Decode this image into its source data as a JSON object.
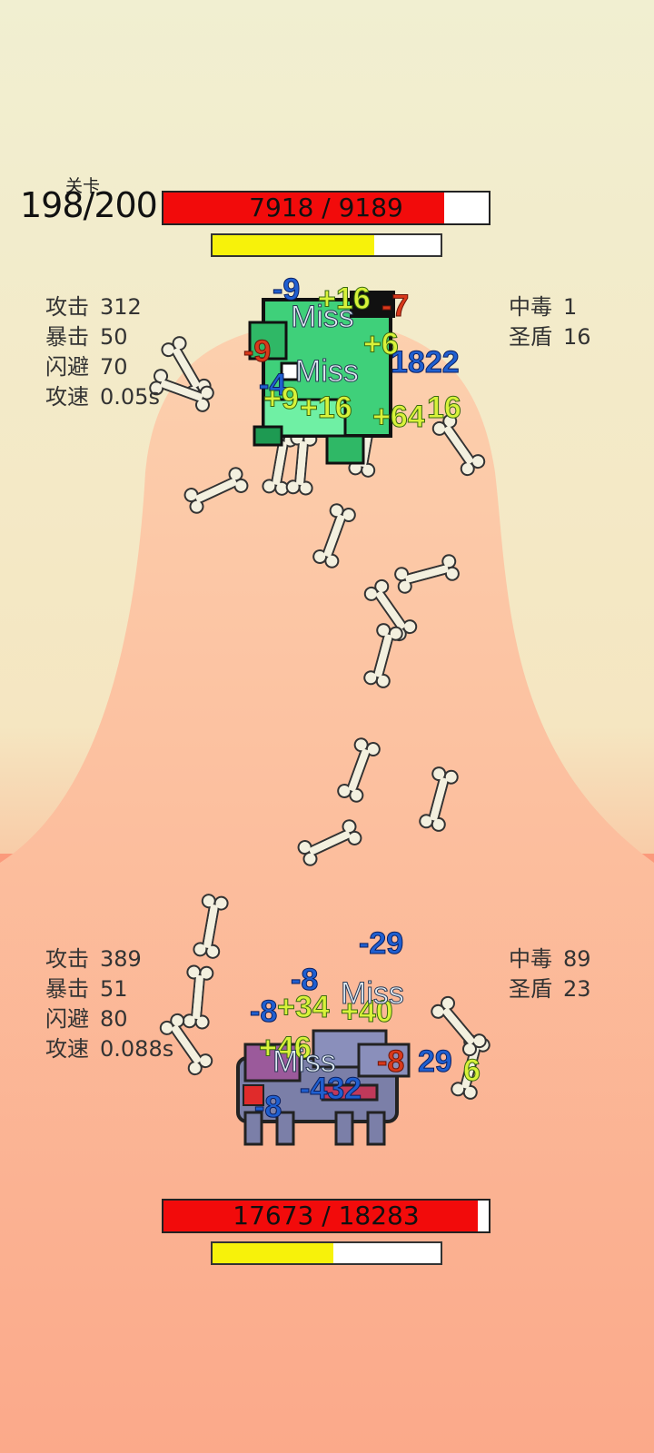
{
  "stage": {
    "label": "关卡",
    "value": "198/200"
  },
  "enemy": {
    "hp_text": "7918 / 9189",
    "hp_fraction": 0.862,
    "energy_fraction": 0.71,
    "stats_left": [
      {
        "name": "攻击",
        "value": "312"
      },
      {
        "name": "暴击",
        "value": "50"
      },
      {
        "name": "闪避",
        "value": "70"
      },
      {
        "name": "攻速",
        "value": "0.05s"
      }
    ],
    "stats_right": [
      {
        "name": "中毒",
        "value": "1"
      },
      {
        "name": "圣盾",
        "value": "16"
      }
    ],
    "floating_numbers": [
      {
        "text": "-9",
        "style": "blue"
      },
      {
        "text": "+16",
        "style": "green"
      },
      {
        "text": "-7",
        "style": "red"
      },
      {
        "text": "Miss",
        "style": "miss"
      },
      {
        "text": "-9",
        "style": "red"
      },
      {
        "text": "+6",
        "style": "green"
      },
      {
        "text": "1822",
        "style": "blue"
      },
      {
        "text": "Miss",
        "style": "miss"
      },
      {
        "text": "-4",
        "style": "blue"
      },
      {
        "text": "+9",
        "style": "green"
      },
      {
        "text": "+16",
        "style": "green"
      },
      {
        "text": "+64",
        "style": "green"
      },
      {
        "text": "16",
        "style": "green"
      }
    ]
  },
  "player": {
    "hp_text": "17673 / 18283",
    "hp_fraction": 0.967,
    "energy_fraction": 0.53,
    "stats_left": [
      {
        "name": "攻击",
        "value": "389"
      },
      {
        "name": "暴击",
        "value": "51"
      },
      {
        "name": "闪避",
        "value": "80"
      },
      {
        "name": "攻速",
        "value": "0.088s"
      }
    ],
    "stats_right": [
      {
        "name": "中毒",
        "value": "89"
      },
      {
        "name": "圣盾",
        "value": "23"
      }
    ],
    "floating_numbers": [
      {
        "text": "-29",
        "style": "blue"
      },
      {
        "text": "-8",
        "style": "blue"
      },
      {
        "text": "-8",
        "style": "blue"
      },
      {
        "text": "+34",
        "style": "green"
      },
      {
        "text": "+40",
        "style": "green"
      },
      {
        "text": "Miss",
        "style": "miss"
      },
      {
        "text": "+46",
        "style": "green"
      },
      {
        "text": "Miss",
        "style": "miss"
      },
      {
        "text": "-432",
        "style": "blue"
      },
      {
        "text": "-8",
        "style": "red"
      },
      {
        "text": "-8",
        "style": "blue"
      },
      {
        "text": "29",
        "style": "blue"
      },
      {
        "text": "6",
        "style": "green"
      }
    ]
  },
  "colors": {
    "sky_top": "#f2efd2",
    "sky_mid": "#f6e2bb",
    "sand_light": "#f9c9a7",
    "sand_dark": "#fb9a7c",
    "hp_red": "#f20b0b",
    "energy_yellow": "#f7f20a"
  }
}
